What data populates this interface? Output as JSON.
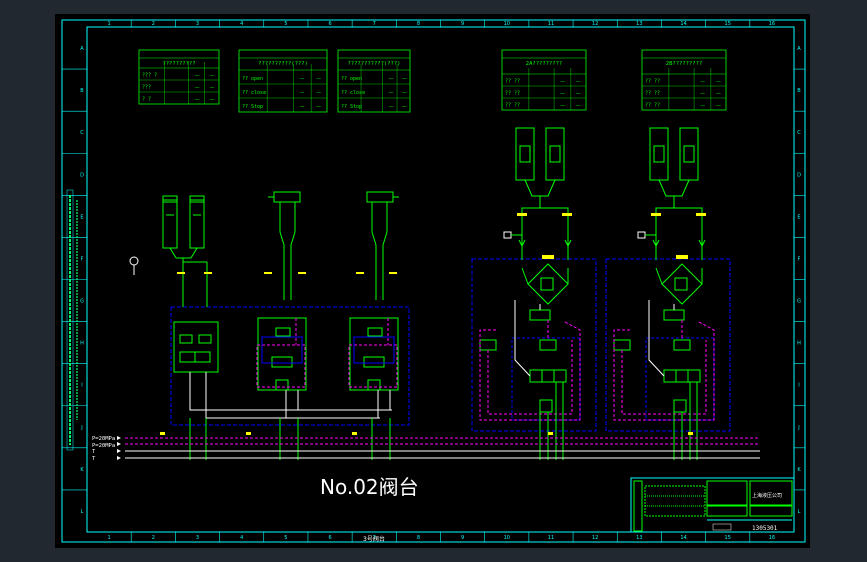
{
  "colors": {
    "background": "#000000",
    "frame": "#00ffff",
    "component": "#00ff00",
    "dashed_blue": "#0000ff",
    "pilot_magenta": "#ff00ff",
    "wire_white": "#ffffff",
    "label_yellow": "#ffff00",
    "label_red": "#ff3030"
  },
  "title": "No.02阀台",
  "bottom_caption": "3号阀台",
  "tables": [
    {
      "header": "??????????",
      "rows": [
        "??? ?",
        "???",
        "? ?"
      ]
    },
    {
      "header": "??????????(???)",
      "rows": [
        "?? open",
        "?? close",
        "?? Stop"
      ]
    },
    {
      "header": "???????????(???)",
      "rows": [
        "?? open",
        "?? close",
        "?? Stop"
      ]
    },
    {
      "header": "2A?????????",
      "rows": [
        "?? ??",
        "?? ??",
        "?? ??"
      ]
    },
    {
      "header": "2B?????????",
      "rows": [
        "?? ??",
        "?? ??",
        "?? ??"
      ]
    }
  ],
  "supply_lines": [
    "P=20MPa",
    "P=20MPa",
    "T",
    "T"
  ],
  "title_block": {
    "company": "上海液压公司",
    "drawing_no": "1305301"
  },
  "column_markers": [
    "1",
    "2",
    "3",
    "4",
    "5",
    "6",
    "7",
    "8",
    "9",
    "10",
    "11",
    "12",
    "13",
    "14",
    "15",
    "16"
  ],
  "row_markers": [
    "A",
    "B",
    "C",
    "D",
    "E",
    "F",
    "G",
    "H",
    "I",
    "J",
    "K",
    "L"
  ]
}
